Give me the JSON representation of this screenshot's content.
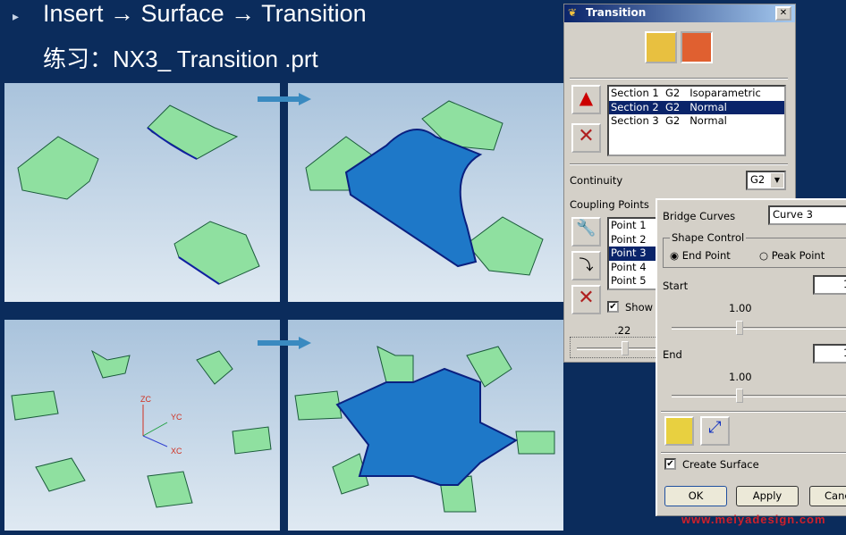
{
  "slide": {
    "bullet": "▸",
    "line1": "Insert → Surface → Transition",
    "line2": "练习：NX3_ Transition .prt",
    "watermark": "www.meiyadesign.com"
  },
  "axes": {
    "zc": "ZC",
    "yc": "YC",
    "xc": "XC"
  },
  "dialog": {
    "title": "Transition",
    "close": "✕",
    "sections": [
      "Section 1  G2   Isoparametric",
      "Section 2  G2   Normal",
      "Section 3  G2   Normal"
    ],
    "selected_section": 1,
    "continuity_label": "Continuity",
    "continuity_value": "G2",
    "coupling_label": "Coupling Points",
    "points": [
      "Point 1",
      "Point 2",
      "Point 3",
      "Point 4",
      "Point 5"
    ],
    "selected_point": 2,
    "show_label": "Show",
    "show_checked": true,
    "slider_value": ".22"
  },
  "sub": {
    "bridge_label": "Bridge Curves",
    "bridge_value": "Curve 3",
    "shape_control": "Shape Control",
    "end_point": "End Point",
    "peak_point": "Peak Point",
    "selected": "End Point",
    "start_label": "Start",
    "start_value": "1.",
    "start_slider": "1.00",
    "end_label": "End",
    "end_value": "1.",
    "end_slider": "1.00",
    "create_surface": "Create Surface",
    "create_checked": true,
    "ok": "OK",
    "apply": "Apply",
    "cancel": "Canc"
  },
  "colors": {
    "background": "#0b2c5c",
    "surface_green": "#8fe0a0",
    "surface_blue": "#1e78c8",
    "selection": "#0a246a"
  }
}
